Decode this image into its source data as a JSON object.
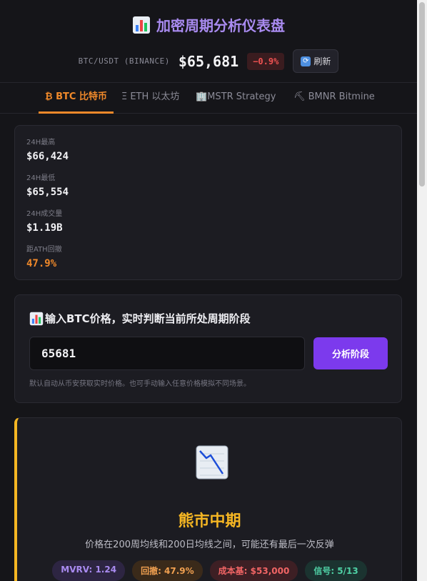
{
  "header": {
    "title": "加密周期分析仪表盘",
    "title_icon": "bar-chart-icon",
    "pair": "BTC/USDT (BINANCE)",
    "price": "$65,681",
    "change": "−0.9%",
    "refresh_label": "刷新",
    "refresh_icon": "refresh-icon"
  },
  "tabs": [
    {
      "label": "₿ BTC 比特币",
      "active": true
    },
    {
      "label": "Ξ ETH 以太坊",
      "active": false
    },
    {
      "label": "🏢MSTR Strategy",
      "active": false
    },
    {
      "label": "⛏ BMNR Bitmine",
      "active": false
    }
  ],
  "stats": [
    {
      "label": "24H最高",
      "value": "$66,424"
    },
    {
      "label": "24H最低",
      "value": "$65,554"
    },
    {
      "label": "24H成交量",
      "value": "$1.19B"
    },
    {
      "label": "距ATH回撤",
      "value": "47.9%"
    }
  ],
  "input_section": {
    "title": "输入BTC价格，实时判断当前所处周期阶段",
    "value": "65681",
    "button_label": "分析阶段",
    "hint": "默认自动从币安获取实时价格。也可手动输入任意价格模拟不同场景。"
  },
  "phase": {
    "icon": "chart-decreasing-icon",
    "title": "熊市中期",
    "description": "价格在200周均线和200日均线之间，可能还有最后一次反弹",
    "badges": [
      {
        "label": "MVRV: 1.24",
        "tone": "purple"
      },
      {
        "label": "回撤: 47.9%",
        "tone": "orange"
      },
      {
        "label": "成本基: $53,000",
        "tone": "red"
      },
      {
        "label": "信号: 5/13",
        "tone": "green"
      }
    ]
  },
  "colors": {
    "accent": "#a98bf0",
    "active_tab": "#f0892a",
    "phase_border": "#f5b623",
    "negative": "#f05252",
    "button": "#7c3aed"
  }
}
